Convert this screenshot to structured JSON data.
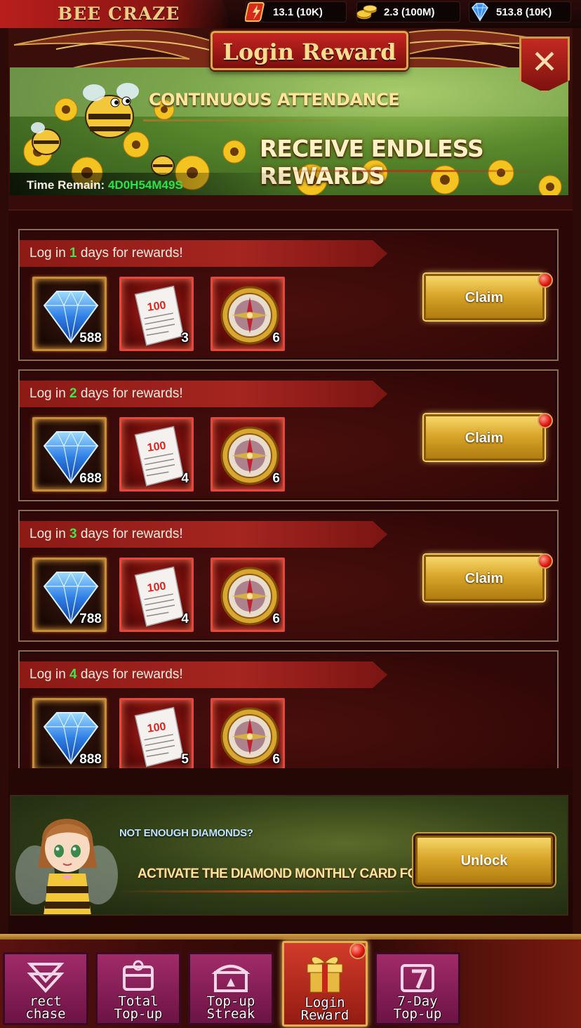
{
  "header": {
    "game_title": "BEE CRAZE",
    "resources": [
      {
        "icon": "energy-icon",
        "value": "13.1 (10K)"
      },
      {
        "icon": "gold-coins-icon",
        "value": "2.3 (100M)"
      },
      {
        "icon": "diamond-icon",
        "value": "513.8 (10K)"
      }
    ]
  },
  "dialog": {
    "title": "Login Reward",
    "close_symbol": "✕"
  },
  "banner": {
    "headline": "CONTINUOUS ATTENDANCE",
    "subheadline": "RECEIVE ENDLESS REWARDS",
    "time_label": "Time Remain:",
    "time_value": "4D0H54M49S"
  },
  "rewards": [
    {
      "prefix": "Log in ",
      "days": "1",
      "suffix": " days for rewards!",
      "diamonds": "588",
      "tickets": "3",
      "compass": "6",
      "button": "Claim"
    },
    {
      "prefix": "Log in ",
      "days": "2",
      "suffix": " days for rewards!",
      "diamonds": "688",
      "tickets": "4",
      "compass": "6",
      "button": "Claim"
    },
    {
      "prefix": "Log in ",
      "days": "3",
      "suffix": " days for rewards!",
      "diamonds": "788",
      "tickets": "4",
      "compass": "6",
      "button": "Claim"
    },
    {
      "prefix": "Log in ",
      "days": "4",
      "suffix": " days for rewards!",
      "diamonds": "888",
      "tickets": "5",
      "compass": "6",
      "button": ""
    }
  ],
  "promo": {
    "question": "NOT ENOUGH DIAMONDS?",
    "message": "ACTIVATE THE DIAMOND MONTHLY CARD FOR SU",
    "button": "Unlock"
  },
  "tabs": [
    {
      "label": "rect\nchase",
      "icon": "direct-purchase-icon",
      "active": false
    },
    {
      "label": "Total\nTop-up",
      "icon": "total-topup-icon",
      "active": false
    },
    {
      "label": "Top-up\nStreak",
      "icon": "chest-icon",
      "active": false
    },
    {
      "label": "Login\nReward",
      "icon": "gift-box-icon",
      "active": true
    },
    {
      "label": "7-Day\nTop-up",
      "icon": "seven-day-icon",
      "active": false
    }
  ],
  "colors": {
    "accent_gold": "#e0b04e",
    "highlight_green": "#3fe44e",
    "frame_red": "#8c1a15",
    "tab_magenta": "#a12b6a"
  }
}
